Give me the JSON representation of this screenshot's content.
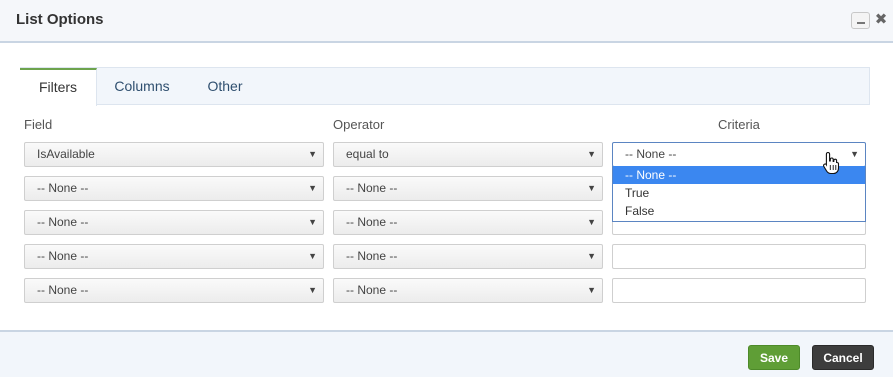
{
  "window": {
    "title": "List Options",
    "minimize_icon": "minimize-icon",
    "close_icon": "close-icon",
    "close_glyph": "✖"
  },
  "tabs": [
    {
      "label": "Filters",
      "active": true
    },
    {
      "label": "Columns",
      "active": false
    },
    {
      "label": "Other",
      "active": false
    }
  ],
  "columns": {
    "field": "Field",
    "operator": "Operator",
    "criteria": "Criteria"
  },
  "rows": [
    {
      "field": "IsAvailable",
      "operator": "equal to",
      "criteria": "-- None --",
      "criteria_type": "select"
    },
    {
      "field": "-- None --",
      "operator": "-- None --",
      "criteria": "",
      "criteria_type": "text"
    },
    {
      "field": "-- None --",
      "operator": "-- None --",
      "criteria": "",
      "criteria_type": "text"
    },
    {
      "field": "-- None --",
      "operator": "-- None --",
      "criteria": "",
      "criteria_type": "text"
    },
    {
      "field": "-- None --",
      "operator": "-- None --",
      "criteria": "",
      "criteria_type": "text"
    }
  ],
  "arrow_glyph": "▼",
  "criteria_dropdown": {
    "open": true,
    "options": [
      "-- None --",
      "True",
      "False"
    ],
    "selected": "-- None --"
  },
  "footer": {
    "save_label": "Save",
    "cancel_label": "Cancel"
  },
  "colors": {
    "accent_green": "#5f9e36",
    "highlight_blue": "#3b87f0",
    "cancel_dark": "#3d3d3d"
  }
}
